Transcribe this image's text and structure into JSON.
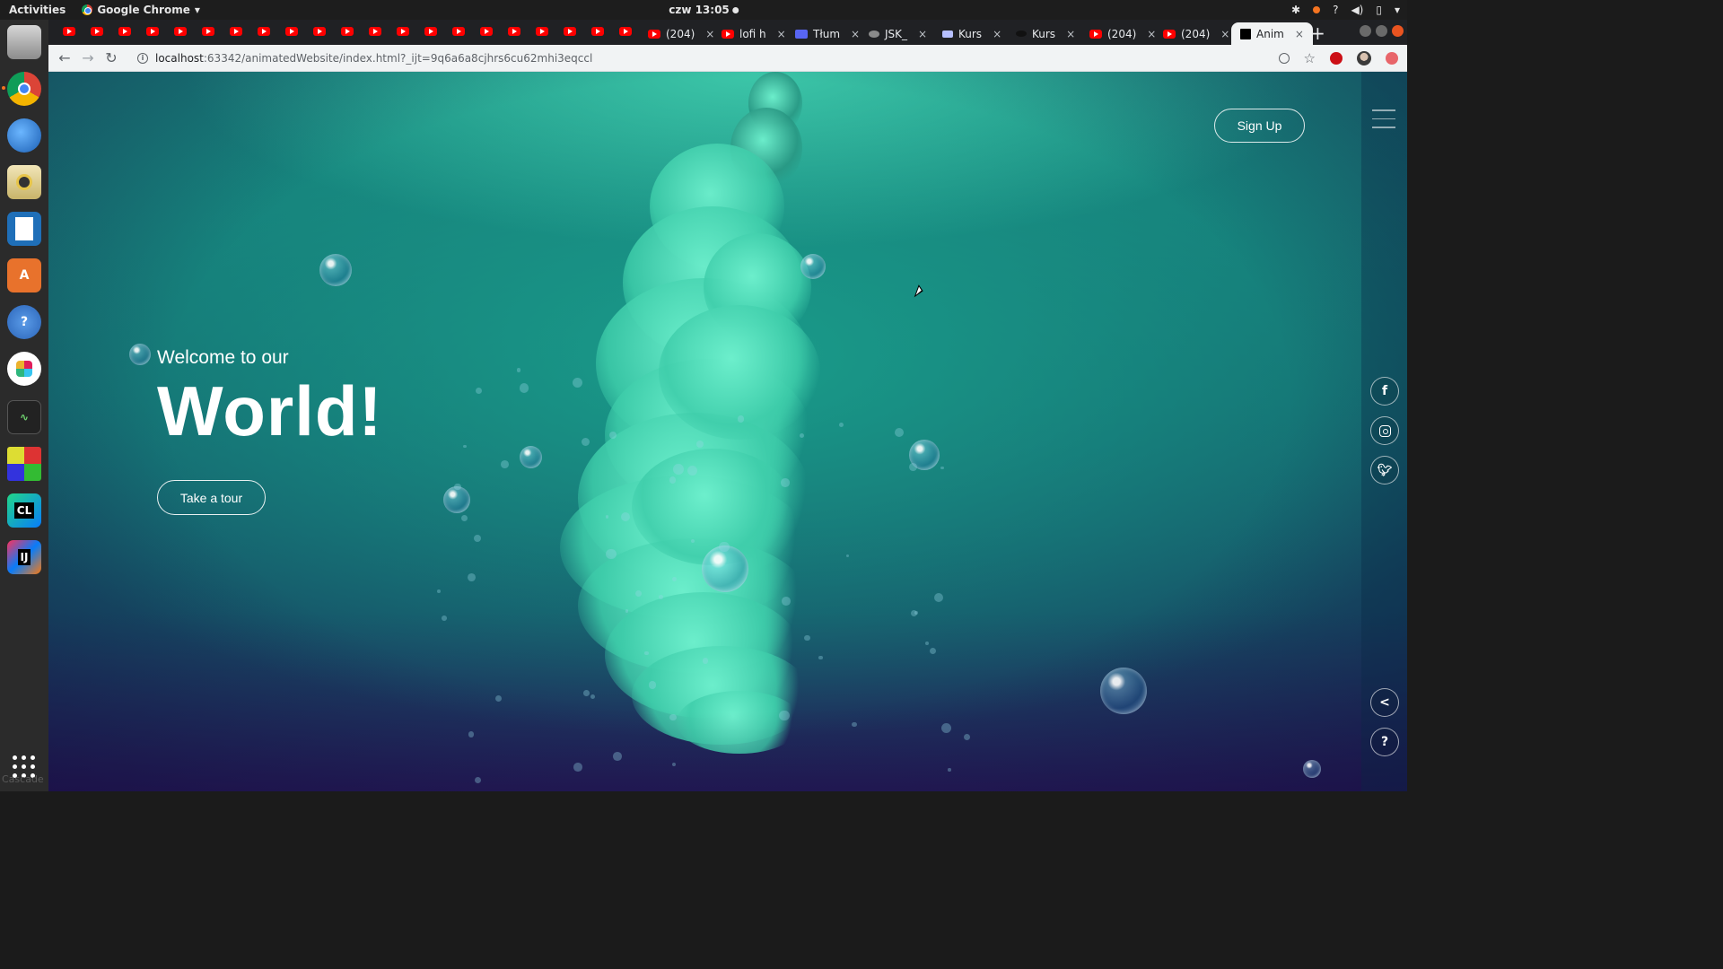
{
  "topbar": {
    "activities": "Activities",
    "app_name": "Google Chrome",
    "clock": "czw 13:05"
  },
  "dock": {
    "items": [
      "files",
      "chrome",
      "thunderbird",
      "rhythmbox",
      "writer",
      "software-center",
      "help",
      "slack",
      "system-monitor",
      "color-app",
      "clion",
      "intellij"
    ],
    "clion_label": "CL",
    "intellij_label": "IJ",
    "cascade_label": "Cascade"
  },
  "tabs": {
    "youtube_icon_tabs": 21,
    "named": [
      {
        "label": "(204)",
        "icon": "youtube-icon"
      },
      {
        "label": "lofi h",
        "icon": "youtube-icon"
      },
      {
        "label": "Tłum",
        "icon": "translate-icon"
      },
      {
        "label": "JSK_",
        "icon": "jsk-icon"
      },
      {
        "label": "Kurs",
        "icon": "course-icon"
      },
      {
        "label": "Kurs",
        "icon": "course-icon"
      },
      {
        "label": "(204)",
        "icon": "youtube-icon"
      },
      {
        "label": "(204)",
        "icon": "youtube-icon"
      },
      {
        "label": "Anim",
        "icon": "intellij-icon",
        "active": true
      }
    ],
    "close_glyph": "×",
    "new_tab_glyph": "+"
  },
  "omnibox": {
    "host": "localhost",
    "path": ":63342/animatedWebsite/index.html?_ijt=9q6a6a8cjhrs6cu62mhi3eqccl"
  },
  "site": {
    "signup_label": "Sign Up",
    "welcome": "Welcome to our",
    "headline": "World!",
    "cta_label": "Take a tour",
    "social": {
      "facebook": "f",
      "share": "<",
      "help": "?"
    }
  },
  "colors": {
    "accent_smoke": "#3ed9b0",
    "page_top": "#17877e",
    "page_bottom": "#231a55",
    "ubuntu_orange": "#e95420"
  }
}
